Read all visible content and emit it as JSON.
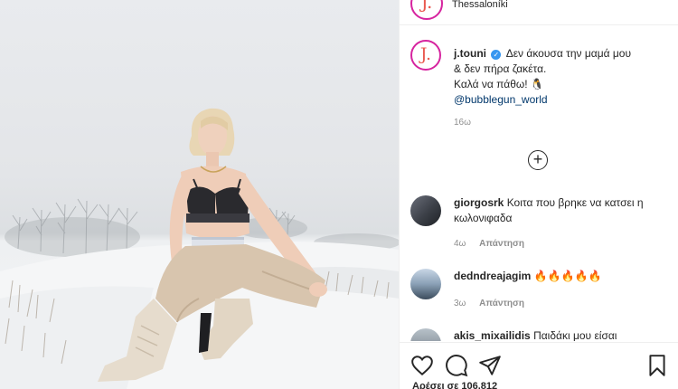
{
  "post": {
    "location": "Thessaloníki",
    "author": {
      "avatar_letter": "J.",
      "username": "j.touni",
      "verified": true
    },
    "caption": {
      "line1": "Δεν άκουσα την μαμά μου",
      "line2": "& δεν πήρα ζακέτα.",
      "line3": "Καλά να πάθω! 🐧",
      "mention": "@bubblegun_world",
      "time": "16ω"
    },
    "load_more_icon": "plus-circle-icon",
    "comments": [
      {
        "username": "giorgosrk",
        "text": "Κοιτα που βρηκε να κατσει η κωλονιφαδα",
        "time": "4ω",
        "reply": "Απάντηση"
      },
      {
        "username": "dedndreajagim",
        "text": "🔥🔥🔥🔥🔥",
        "time": "3ω",
        "reply": "Απάντηση"
      },
      {
        "username": "akis_mixailidis",
        "text": "Παιδάκι μου είσαι"
      }
    ],
    "actions": {
      "like_icon": "heart-icon",
      "comment_icon": "comment-icon",
      "share_icon": "paper-plane-icon",
      "save_icon": "bookmark-icon"
    },
    "likes_text": "Αρέσει σε 106.812"
  },
  "colors": {
    "verified": "#3897f0",
    "mention": "#00376b",
    "meta": "#8e8e8e",
    "brand_ring": "#d6249f"
  }
}
